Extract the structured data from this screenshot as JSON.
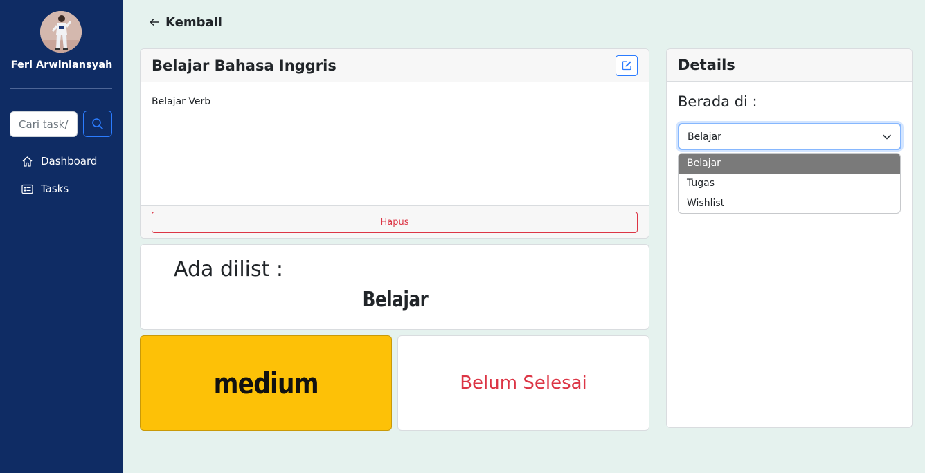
{
  "sidebar": {
    "user_name": "Feri Arwiniansyah",
    "search": {
      "placeholder": "Cari task/list"
    },
    "nav": [
      {
        "label": "Dashboard",
        "icon": "home-icon"
      },
      {
        "label": "Tasks",
        "icon": "list-card-icon"
      }
    ],
    "background_color": "#0f2c64"
  },
  "back": {
    "label": "Kembali"
  },
  "task": {
    "title": "Belajar Bahasa Inggris",
    "description": "Belajar Verb",
    "delete_label": "Hapus"
  },
  "list_info": {
    "label": "Ada dilist :",
    "list_name": "Belajar"
  },
  "priority": {
    "label": "medium",
    "color": "#fdc107"
  },
  "status": {
    "label": "Belum Selesai",
    "color": "#dc3545"
  },
  "details": {
    "title": "Details",
    "located_label": "Berada di :",
    "selected": "Belajar",
    "options": [
      "Belajar",
      "Tugas",
      "Wishlist"
    ]
  }
}
